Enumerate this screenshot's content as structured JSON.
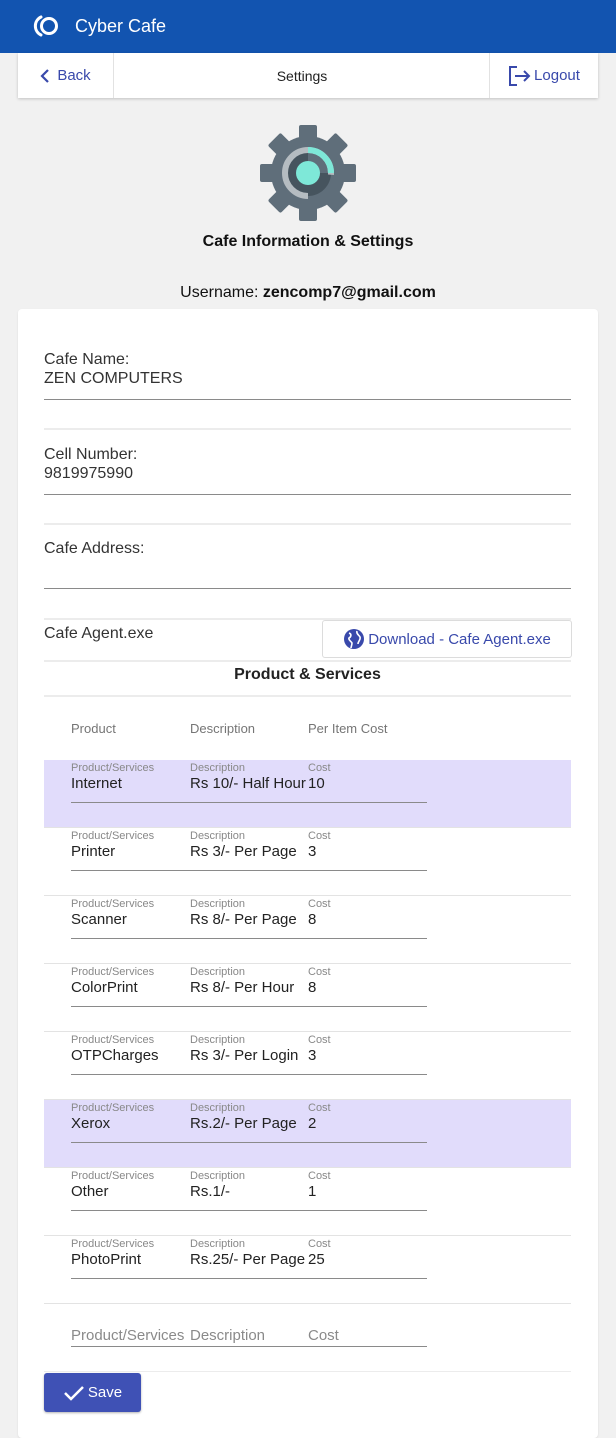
{
  "app": {
    "title": "Cyber Cafe"
  },
  "toolbar": {
    "back_label": "Back",
    "title": "Settings",
    "logout_label": "Logout"
  },
  "header": {
    "heading": "Cafe Information & Settings",
    "username_label": "Username:",
    "username": "zencomp7@gmail.com"
  },
  "form": {
    "cafe_name": {
      "label": "Cafe Name:",
      "value": "ZEN COMPUTERS"
    },
    "cell_number": {
      "label": "Cell Number:",
      "value": "9819975990"
    },
    "cafe_address": {
      "label": "Cafe Address:",
      "value": ""
    },
    "cafe_agent": {
      "label": "Cafe Agent.exe",
      "button_label": "Download - Cafe Agent.exe"
    }
  },
  "products": {
    "section_title": "Product & Services",
    "columns": [
      "Product",
      "Description",
      "Per Item Cost"
    ],
    "field_labels": {
      "product": "Product/Services",
      "description": "Description",
      "cost": "Cost"
    },
    "rows": [
      {
        "product": "Internet",
        "description": "Rs 10/- Half Hour",
        "cost": "10",
        "highlighted": true
      },
      {
        "product": "Printer",
        "description": "Rs 3/- Per Page",
        "cost": "3",
        "highlighted": false
      },
      {
        "product": "Scanner",
        "description": "Rs 8/- Per Page",
        "cost": "8",
        "highlighted": false
      },
      {
        "product": "ColorPrint",
        "description": "Rs 8/- Per Hour",
        "cost": "8",
        "highlighted": false
      },
      {
        "product": "OTPCharges",
        "description": "Rs 3/- Per Login",
        "cost": "3",
        "highlighted": false
      },
      {
        "product": "Xerox",
        "description": "Rs.2/- Per Page",
        "cost": "2",
        "highlighted": true
      },
      {
        "product": "Other",
        "description": "Rs.1/-",
        "cost": "1",
        "highlighted": false
      },
      {
        "product": "PhotoPrint",
        "description": "Rs.25/- Per Page",
        "cost": "25",
        "highlighted": false
      }
    ],
    "new_row": {
      "product_placeholder": "Product/Services",
      "description_placeholder": "Description",
      "cost_placeholder": "Cost"
    }
  },
  "save_label": "Save",
  "colors": {
    "primary": "#1254b0",
    "accent": "#3f51b5",
    "highlight": "#e1dcfb"
  }
}
